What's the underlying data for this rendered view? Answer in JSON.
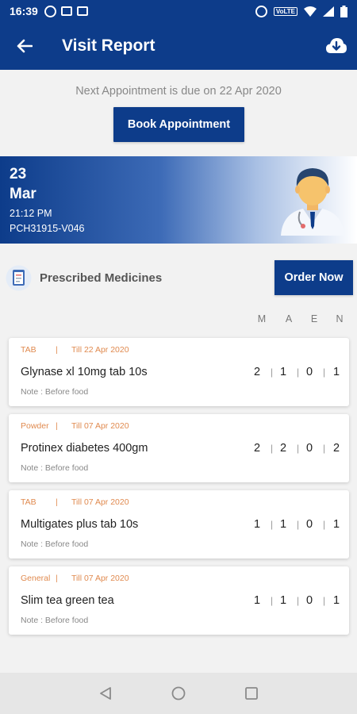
{
  "status_bar": {
    "time": "16:39",
    "network": "VoLTE"
  },
  "header": {
    "title": "Visit Report"
  },
  "appointment": {
    "next_text": "Next Appointment is due on 22 Apr 2020",
    "book_label": "Book Appointment"
  },
  "visit": {
    "day": "23",
    "month": "Mar",
    "time": "21:12 PM",
    "id": "PCH31915-V046"
  },
  "prescribed": {
    "title": "Prescribed Medicines",
    "order_label": "Order Now"
  },
  "columns": [
    "M",
    "A",
    "E",
    "N"
  ],
  "medicines": [
    {
      "form": "TAB",
      "till": "Till 22 Apr 2020",
      "name": "Glynase xl 10mg tab 10s",
      "note": "Note : Before food",
      "dose": [
        "2",
        "1",
        "0",
        "1"
      ]
    },
    {
      "form": "Powder",
      "till": "Till 07 Apr 2020",
      "name": "Protinex diabetes 400gm",
      "note": "Note : Before food",
      "dose": [
        "2",
        "2",
        "0",
        "2"
      ]
    },
    {
      "form": "TAB",
      "till": "Till 07 Apr 2020",
      "name": "Multigates plus tab 10s",
      "note": "Note : Before food",
      "dose": [
        "1",
        "1",
        "0",
        "1"
      ]
    },
    {
      "form": "General",
      "till": "Till 07 Apr 2020",
      "name": "Slim tea green tea",
      "note": "Note : Before food",
      "dose": [
        "1",
        "1",
        "0",
        "1"
      ]
    }
  ],
  "colors": {
    "primary": "#0d3c8a",
    "accent_orange": "#e08a4f"
  }
}
